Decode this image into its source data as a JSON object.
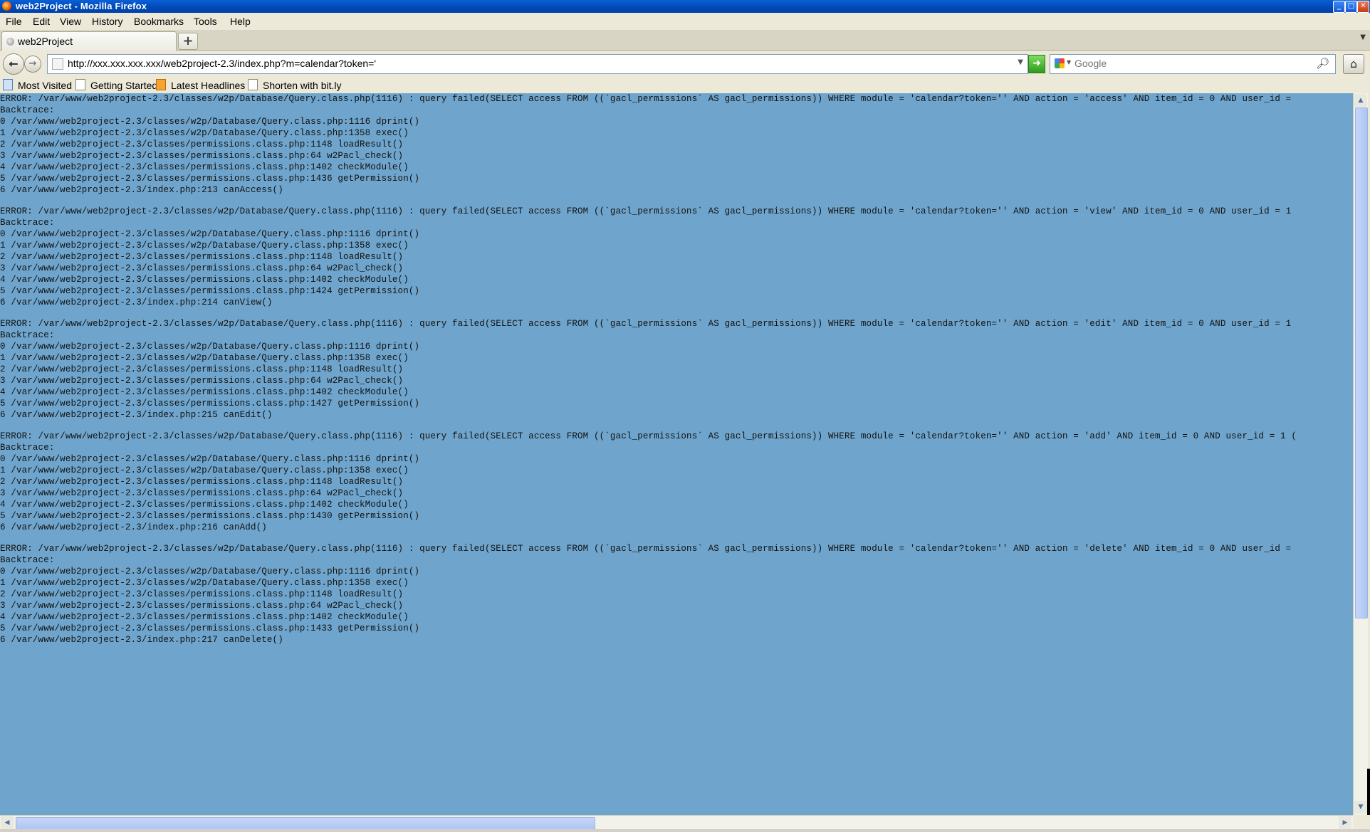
{
  "window": {
    "title": "web2Project - Mozilla Firefox",
    "buttons": {
      "minimize": "_",
      "maximize": "□",
      "close": "✕"
    }
  },
  "menu": [
    "File",
    "Edit",
    "View",
    "History",
    "Bookmarks",
    "Tools",
    "Help"
  ],
  "tab": {
    "label": "web2Project",
    "new_tab": "+"
  },
  "nav": {
    "back": "←",
    "forward": "→",
    "url": "http://xxx.xxx.xxx.xxx/web2project-2.3/index.php?m=calendar?token='",
    "go": "➜",
    "home": "⌂",
    "dropdown": "▼"
  },
  "search": {
    "placeholder": "Google",
    "icon": "search-icon"
  },
  "bookmarks": [
    "Most Visited",
    "Getting Started",
    "Latest Headlines",
    "Shorten with bit.ly"
  ],
  "errors": [
    {
      "error": "ERROR: /var/www/web2project-2.3/classes/w2p/Database/Query.class.php(1116) : query failed(SELECT access FROM ((`gacl_permissions` AS gacl_permissions)) WHERE module = 'calendar?token='' AND action = 'access' AND item_id = 0 AND user_id =",
      "trace": [
        "Backtrace:",
        "0 /var/www/web2project-2.3/classes/w2p/Database/Query.class.php:1116 dprint()",
        "1 /var/www/web2project-2.3/classes/w2p/Database/Query.class.php:1358 exec()",
        "2 /var/www/web2project-2.3/classes/permissions.class.php:1148 loadResult()",
        "3 /var/www/web2project-2.3/classes/permissions.class.php:64 w2Pacl_check()",
        "4 /var/www/web2project-2.3/classes/permissions.class.php:1402 checkModule()",
        "5 /var/www/web2project-2.3/classes/permissions.class.php:1436 getPermission()",
        "6 /var/www/web2project-2.3/index.php:213 canAccess()"
      ]
    },
    {
      "error": "ERROR: /var/www/web2project-2.3/classes/w2p/Database/Query.class.php(1116) : query failed(SELECT access FROM ((`gacl_permissions` AS gacl_permissions)) WHERE module = 'calendar?token='' AND action = 'view' AND item_id = 0 AND user_id = 1",
      "trace": [
        "Backtrace:",
        "0 /var/www/web2project-2.3/classes/w2p/Database/Query.class.php:1116 dprint()",
        "1 /var/www/web2project-2.3/classes/w2p/Database/Query.class.php:1358 exec()",
        "2 /var/www/web2project-2.3/classes/permissions.class.php:1148 loadResult()",
        "3 /var/www/web2project-2.3/classes/permissions.class.php:64 w2Pacl_check()",
        "4 /var/www/web2project-2.3/classes/permissions.class.php:1402 checkModule()",
        "5 /var/www/web2project-2.3/classes/permissions.class.php:1424 getPermission()",
        "6 /var/www/web2project-2.3/index.php:214 canView()"
      ]
    },
    {
      "error": "ERROR: /var/www/web2project-2.3/classes/w2p/Database/Query.class.php(1116) : query failed(SELECT access FROM ((`gacl_permissions` AS gacl_permissions)) WHERE module = 'calendar?token='' AND action = 'edit' AND item_id = 0 AND user_id = 1",
      "trace": [
        "Backtrace:",
        "0 /var/www/web2project-2.3/classes/w2p/Database/Query.class.php:1116 dprint()",
        "1 /var/www/web2project-2.3/classes/w2p/Database/Query.class.php:1358 exec()",
        "2 /var/www/web2project-2.3/classes/permissions.class.php:1148 loadResult()",
        "3 /var/www/web2project-2.3/classes/permissions.class.php:64 w2Pacl_check()",
        "4 /var/www/web2project-2.3/classes/permissions.class.php:1402 checkModule()",
        "5 /var/www/web2project-2.3/classes/permissions.class.php:1427 getPermission()",
        "6 /var/www/web2project-2.3/index.php:215 canEdit()"
      ]
    },
    {
      "error": "ERROR: /var/www/web2project-2.3/classes/w2p/Database/Query.class.php(1116) : query failed(SELECT access FROM ((`gacl_permissions` AS gacl_permissions)) WHERE module = 'calendar?token='' AND action = 'add' AND item_id = 0 AND user_id = 1 (",
      "trace": [
        "Backtrace:",
        "0 /var/www/web2project-2.3/classes/w2p/Database/Query.class.php:1116 dprint()",
        "1 /var/www/web2project-2.3/classes/w2p/Database/Query.class.php:1358 exec()",
        "2 /var/www/web2project-2.3/classes/permissions.class.php:1148 loadResult()",
        "3 /var/www/web2project-2.3/classes/permissions.class.php:64 w2Pacl_check()",
        "4 /var/www/web2project-2.3/classes/permissions.class.php:1402 checkModule()",
        "5 /var/www/web2project-2.3/classes/permissions.class.php:1430 getPermission()",
        "6 /var/www/web2project-2.3/index.php:216 canAdd()"
      ]
    },
    {
      "error": "ERROR: /var/www/web2project-2.3/classes/w2p/Database/Query.class.php(1116) : query failed(SELECT access FROM ((`gacl_permissions` AS gacl_permissions)) WHERE module = 'calendar?token='' AND action = 'delete' AND item_id = 0 AND user_id =",
      "trace": [
        "Backtrace:",
        "0 /var/www/web2project-2.3/classes/w2p/Database/Query.class.php:1116 dprint()",
        "1 /var/www/web2project-2.3/classes/w2p/Database/Query.class.php:1358 exec()",
        "2 /var/www/web2project-2.3/classes/permissions.class.php:1148 loadResult()",
        "3 /var/www/web2project-2.3/classes/permissions.class.php:64 w2Pacl_check()",
        "4 /var/www/web2project-2.3/classes/permissions.class.php:1402 checkModule()",
        "5 /var/www/web2project-2.3/classes/permissions.class.php:1433 getPermission()",
        "6 /var/www/web2project-2.3/index.php:217 canDelete()"
      ]
    }
  ],
  "scrollbar": {
    "up": "▲",
    "down": "▼",
    "left": "◀",
    "right": "▶",
    "grip": "|||"
  },
  "colors": {
    "content_bg": "#6fa5cc",
    "titlebar": "#0048b5",
    "chrome": "#ece9d8"
  }
}
